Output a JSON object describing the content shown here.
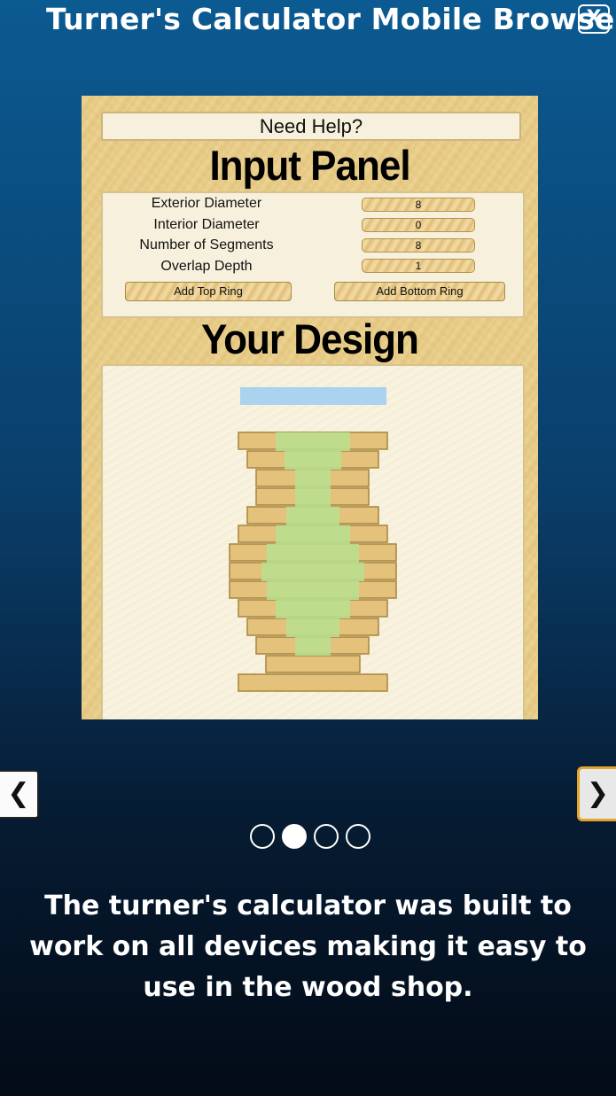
{
  "header": {
    "title": "Turner's Calculator Mobile Browser",
    "close_label": "X"
  },
  "slide": {
    "help_button": "Need Help?",
    "input_panel_heading": "Input Panel",
    "fields": [
      {
        "label": "Exterior Diameter",
        "value": "8"
      },
      {
        "label": "Interior Diameter",
        "value": "0"
      },
      {
        "label": "Number of Segments",
        "value": "8"
      },
      {
        "label": "Overlap Depth",
        "value": "1"
      }
    ],
    "add_top_ring": "Add Top Ring",
    "add_bottom_ring": "Add Bottom Ring",
    "design_heading": "Your Design",
    "colors": {
      "wood": "#e4c27c",
      "wood_border": "#a6843c",
      "inner_profile": "#b9e08f",
      "top_marker": "#a9d3ef"
    }
  },
  "navigation": {
    "prev_label": "❮",
    "next_label": "❯",
    "slide_count": 4,
    "active_slide": 2
  },
  "caption": "The turner's calculator was built to work on all devices making it easy to use in the wood shop."
}
